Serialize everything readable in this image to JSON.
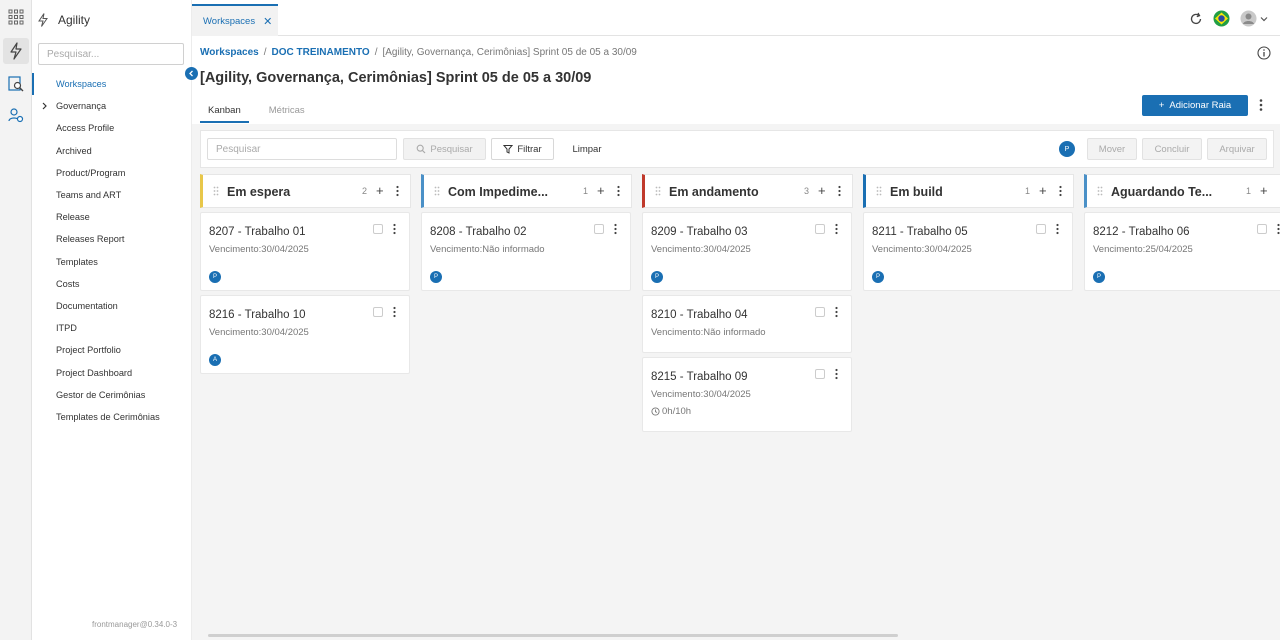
{
  "app": {
    "name": "Agility",
    "version": "frontmanager@0.34.0-3"
  },
  "colors": {
    "accent": "#1a6fb3",
    "lane_em_espera": "#e8c74a",
    "lane_com_impedimento": "#4a90c7",
    "lane_em_andamento": "#c0392b",
    "lane_em_build": "#1a6fb3",
    "lane_aguardando": "#4a90c7"
  },
  "rail": {
    "icons": [
      "apps-grid-icon",
      "lightning-icon",
      "report-search-icon",
      "settings-group-icon"
    ]
  },
  "sidebar": {
    "search_placeholder": "Pesquisar...",
    "items": [
      {
        "label": "Workspaces",
        "active": true
      },
      {
        "label": "Governança",
        "expandable": true
      },
      {
        "label": "Access Profile"
      },
      {
        "label": "Archived"
      },
      {
        "label": "Product/Program"
      },
      {
        "label": "Teams and ART"
      },
      {
        "label": "Release"
      },
      {
        "label": "Releases Report"
      },
      {
        "label": "Templates"
      },
      {
        "label": "Costs"
      },
      {
        "label": "Documentation"
      },
      {
        "label": "ITPD"
      },
      {
        "label": "Project Portfolio"
      },
      {
        "label": "Project Dashboard"
      },
      {
        "label": "Gestor de Cerimônias"
      },
      {
        "label": "Templates de Cerimônias"
      }
    ]
  },
  "tabs": [
    {
      "label": "Workspaces",
      "close": "✕"
    }
  ],
  "topbar": {
    "icons": [
      "refresh-icon",
      "brazil-flag-icon",
      "user-avatar-icon",
      "chevron-down-icon"
    ]
  },
  "breadcrumb": {
    "items": [
      "Workspaces",
      "DOC TREINAMENTO"
    ],
    "separator": "/",
    "current": "[Agility, Governança, Cerimônias] Sprint 05 de 05 a 30/09"
  },
  "page": {
    "title": "[Agility, Governança, Cerimônias] Sprint 05 de 05 a 30/09",
    "subtabs": [
      {
        "label": "Kanban",
        "active": true
      },
      {
        "label": "Métricas",
        "active": false
      }
    ],
    "add_lane_label": "Adicionar Raia"
  },
  "toolbar": {
    "search_placeholder": "Pesquisar",
    "search_label": "Pesquisar",
    "filter_label": "Filtrar",
    "clear_label": "Limpar",
    "avatar_initial": "P",
    "move_label": "Mover",
    "done_label": "Concluir",
    "archive_label": "Arquivar"
  },
  "columns": [
    {
      "title": "Em espera",
      "count": "2",
      "cards": [
        {
          "title": "8207 - Trabalho 01",
          "due": "Vencimento:30/04/2025",
          "avatar": "P"
        },
        {
          "title": "8216 - Trabalho 10",
          "due": "Vencimento:30/04/2025",
          "avatar": "A"
        }
      ]
    },
    {
      "title": "Com Impedime...",
      "count": "1",
      "cards": [
        {
          "title": "8208 - Trabalho 02",
          "due": "Vencimento:Não informado",
          "avatar": "P"
        }
      ]
    },
    {
      "title": "Em andamento",
      "count": "3",
      "cards": [
        {
          "title": "8209 - Trabalho 03",
          "due": "Vencimento:30/04/2025",
          "avatar": "P"
        },
        {
          "title": "8210 - Trabalho 04",
          "due": "Vencimento:Não informado"
        },
        {
          "title": "8215 - Trabalho 09",
          "due": "Vencimento:30/04/2025",
          "hours": "0h/10h"
        }
      ]
    },
    {
      "title": "Em build",
      "count": "1",
      "cards": [
        {
          "title": "8211 - Trabalho 05",
          "due": "Vencimento:30/04/2025",
          "avatar": "P"
        }
      ]
    },
    {
      "title": "Aguardando Te...",
      "count": "1",
      "cards": [
        {
          "title": "8212 - Trabalho 06",
          "due": "Vencimento:25/04/2025",
          "avatar": "P"
        }
      ]
    }
  ]
}
